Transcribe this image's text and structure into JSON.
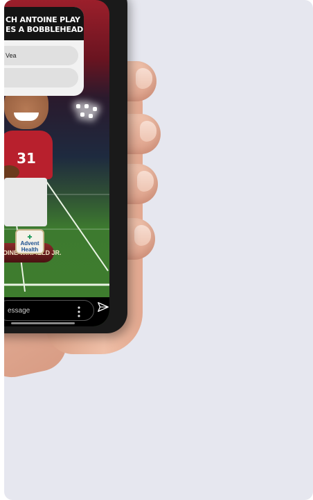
{
  "poll": {
    "title_line1": "CH ANTOINE PLAY",
    "title_line2": "ES A BOBBLEHEAD NOD",
    "options": [
      "Vea",
      ""
    ]
  },
  "bobblehead": {
    "jersey_number": "31",
    "nameplate": "OINE WINFIELD JR.",
    "sponsor_line1": "Advent",
    "sponsor_line2": "Health"
  },
  "message_bar": {
    "placeholder": "essage"
  },
  "icons": {
    "more": "more-vertical-icon",
    "send": "send-paper-plane-icon"
  },
  "colors": {
    "background": "#e6e7ef",
    "jersey_red": "#b8202d",
    "field_green": "#3f7e2e"
  }
}
